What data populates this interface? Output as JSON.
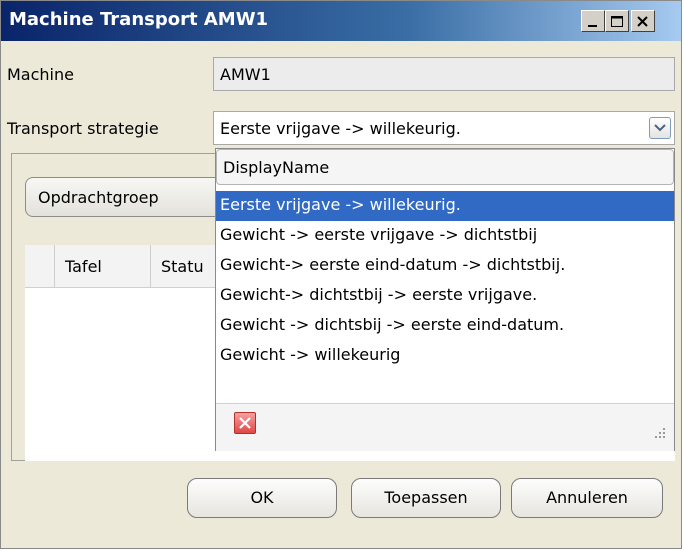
{
  "window": {
    "title": "Machine Transport AMW1",
    "controls": [
      "minimize-icon",
      "maximize-icon",
      "close-icon"
    ]
  },
  "form": {
    "machine_label": "Machine",
    "machine_value": "AMW1",
    "strategy_label": "Transport strategie",
    "strategy_value": "Eerste vrijgave -> willekeurig."
  },
  "panel": {
    "group_button": "Opdrachtgroep",
    "grid_columns": [
      "Tafel",
      "Statu"
    ]
  },
  "dropdown": {
    "header": "DisplayName",
    "selected_index": 0,
    "options": [
      "Eerste vrijgave -> willekeurig.",
      "Gewicht -> eerste vrijgave -> dichtstbij",
      "Gewicht-> eerste eind-datum -> dichtstbij.",
      "Gewicht-> dichtstbij -> eerste vrijgave.",
      "Gewicht -> dichtsbij -> eerste eind-datum.",
      "Gewicht -> willekeurig"
    ],
    "clear_icon": "close-icon",
    "colors": {
      "selection": "#316ac5",
      "clear": "#e04848"
    }
  },
  "buttons": {
    "ok": "OK",
    "apply": "Toepassen",
    "cancel": "Annuleren"
  },
  "colors": {
    "titlebar_start": "#0a246a",
    "titlebar_end": "#a6caf0",
    "background": "#ece9d8"
  }
}
